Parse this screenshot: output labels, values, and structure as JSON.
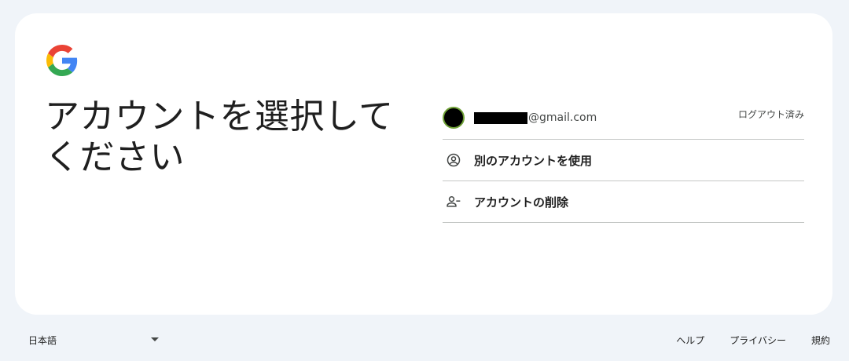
{
  "headline": "アカウントを選択してください",
  "account": {
    "email_suffix": "@gmail.com",
    "status": "ログアウト済み"
  },
  "actions": [
    {
      "label": "別のアカウントを使用",
      "icon": "account-circle-icon"
    },
    {
      "label": "アカウントの削除",
      "icon": "person-remove-icon"
    }
  ],
  "footer": {
    "language": "日本語",
    "links": [
      "ヘルプ",
      "プライバシー",
      "規約"
    ]
  },
  "colors": {
    "background": "#f0f4f9",
    "card": "#ffffff",
    "divider": "#c4c7c5",
    "avatar_ring": "#6fa136"
  }
}
